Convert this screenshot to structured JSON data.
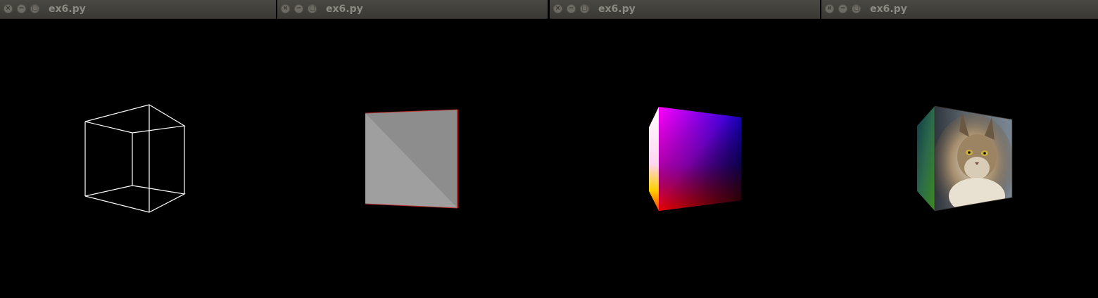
{
  "windows": [
    {
      "title": "ex6.py",
      "render_mode": "wireframe-cube"
    },
    {
      "title": "ex6.py",
      "render_mode": "flat-shaded-face"
    },
    {
      "title": "ex6.py",
      "render_mode": "vertex-color-cube"
    },
    {
      "title": "ex6.py",
      "render_mode": "textured-cube"
    }
  ],
  "titlebar_buttons": {
    "close_icon": "×",
    "minimize_icon": "−",
    "maximize_icon": "□"
  },
  "colors": {
    "titlebar": "#3f3e39",
    "title_text": "#8c8a82",
    "background": "#000000",
    "wireframe": "#ffffff",
    "flat_face": "#9a9a9a",
    "edge_red": "#ff0000"
  }
}
